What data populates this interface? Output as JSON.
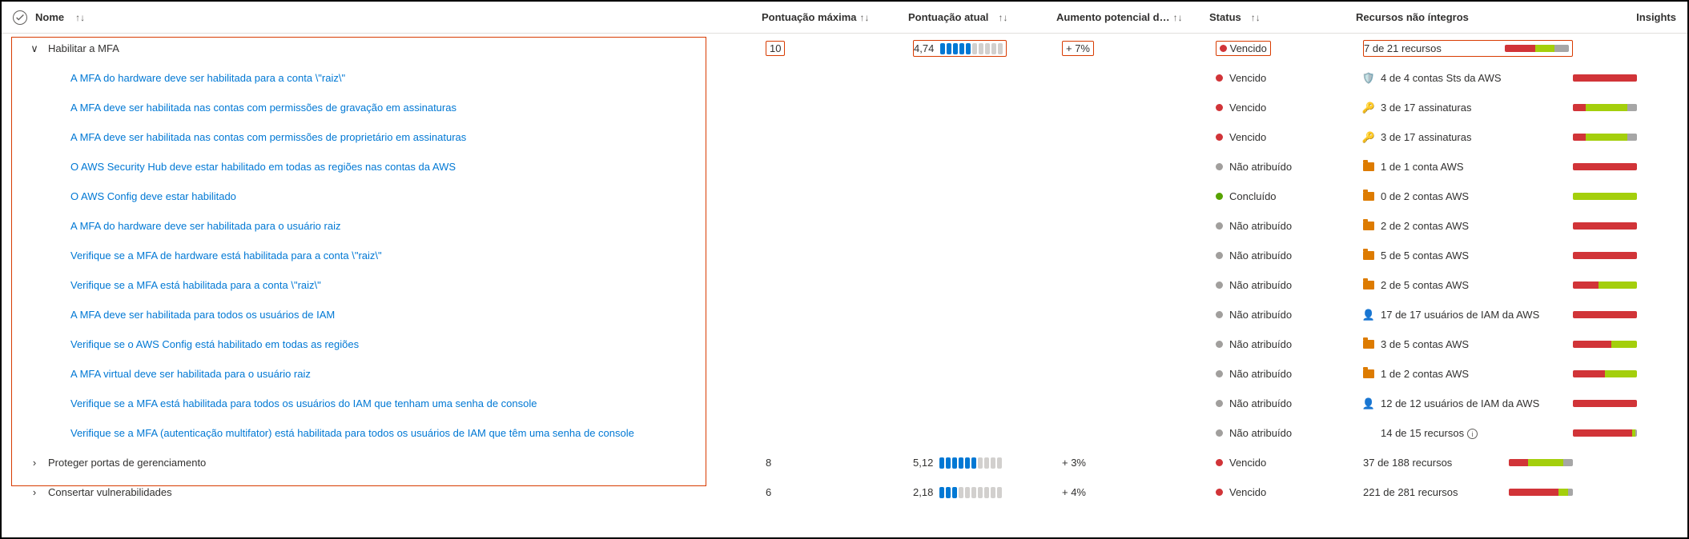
{
  "columns": {
    "name": "Nome",
    "max": "Pontuação máxima",
    "cur": "Pontuação atual",
    "inc": "Aumento potencial d…",
    "status": "Status",
    "res": "Recursos não íntegros",
    "ins": "Insights"
  },
  "sortGlyph": "↑↓",
  "statuses": {
    "vencido": "Vencido",
    "nao": "Não atribuído",
    "conc": "Concluído"
  },
  "groups": [
    {
      "name": "Habilitar a MFA",
      "expanded": true,
      "highlighted": true,
      "max": "10",
      "cur": "4,74",
      "segs": 5,
      "inc": "+ 7%",
      "status": "vencido",
      "res": "7 de 21 recursos",
      "bar": [
        48,
        30,
        22
      ],
      "items": [
        {
          "name": "A MFA do hardware deve ser habilitada para a conta \\\"raiz\\\"",
          "status": "vencido",
          "icon": "shield",
          "res": "4 de 4 contas Sts da AWS",
          "bar": [
            100,
            0,
            0
          ]
        },
        {
          "name": "A MFA deve ser habilitada nas contas com permissões de gravação em assinaturas",
          "status": "vencido",
          "icon": "key",
          "res": "3 de 17 assinaturas",
          "bar": [
            20,
            65,
            15
          ]
        },
        {
          "name": "A MFA deve ser habilitada nas contas com permissões de proprietário em assinaturas",
          "status": "vencido",
          "icon": "key",
          "res": "3 de 17 assinaturas",
          "bar": [
            20,
            65,
            15
          ]
        },
        {
          "name": "O AWS Security Hub deve estar habilitado em todas as regiões nas contas da AWS",
          "status": "nao",
          "icon": "folder",
          "res": "1 de 1 conta AWS",
          "bar": [
            100,
            0,
            0
          ]
        },
        {
          "name": "O AWS Config deve estar habilitado",
          "status": "conc",
          "icon": "folder",
          "res": "0 de 2 contas AWS",
          "bar": [
            0,
            100,
            0
          ]
        },
        {
          "name": "A MFA do hardware deve ser habilitada para o usuário raiz",
          "status": "nao",
          "icon": "folder",
          "res": "2 de 2 contas AWS",
          "bar": [
            100,
            0,
            0
          ]
        },
        {
          "name": "Verifique se a MFA de hardware está habilitada para a conta \\\"raiz\\\"",
          "status": "nao",
          "icon": "folder",
          "res": "5 de 5 contas AWS",
          "bar": [
            100,
            0,
            0
          ]
        },
        {
          "name": "Verifique se a MFA está habilitada para a conta \\\"raiz\\\"",
          "status": "nao",
          "icon": "folder",
          "res": "2 de 5 contas AWS",
          "bar": [
            40,
            60,
            0
          ]
        },
        {
          "name": "A MFA deve ser habilitada para todos os usuários de IAM",
          "status": "nao",
          "icon": "user",
          "res": "17 de 17 usuários de IAM da AWS",
          "bar": [
            100,
            0,
            0
          ]
        },
        {
          "name": "Verifique se o AWS Config está habilitado em todas as regiões",
          "status": "nao",
          "icon": "folder",
          "res": "3 de 5 contas AWS",
          "bar": [
            60,
            40,
            0
          ]
        },
        {
          "name": "A MFA virtual deve ser habilitada para o usuário raiz",
          "status": "nao",
          "icon": "folder",
          "res": "1 de 2 contas AWS",
          "bar": [
            50,
            50,
            0
          ]
        },
        {
          "name": "Verifique se a MFA está habilitada para todos os usuários do IAM que tenham uma senha de console",
          "status": "nao",
          "icon": "user",
          "res": "12 de 12 usuários de IAM da AWS",
          "bar": [
            100,
            0,
            0
          ]
        },
        {
          "name": "Verifique se a MFA (autenticação multifator) está habilitada para todos os usuários de IAM que têm uma senha de console",
          "status": "nao",
          "icon": "",
          "res": "14 de 15 recursos",
          "bar": [
            93,
            4,
            3
          ],
          "info": true
        }
      ]
    },
    {
      "name": "Proteger portas de gerenciamento",
      "expanded": false,
      "max": "8",
      "cur": "5,12",
      "segs": 6,
      "inc": "+ 3%",
      "status": "vencido",
      "res": "37 de 188 recursos",
      "bar": [
        30,
        55,
        15
      ]
    },
    {
      "name": "Consertar vulnerabilidades",
      "expanded": false,
      "max": "6",
      "cur": "2,18",
      "segs": 3,
      "inc": "+ 4%",
      "status": "vencido",
      "res": "221 de 281 recursos",
      "bar": [
        78,
        15,
        7
      ]
    }
  ]
}
